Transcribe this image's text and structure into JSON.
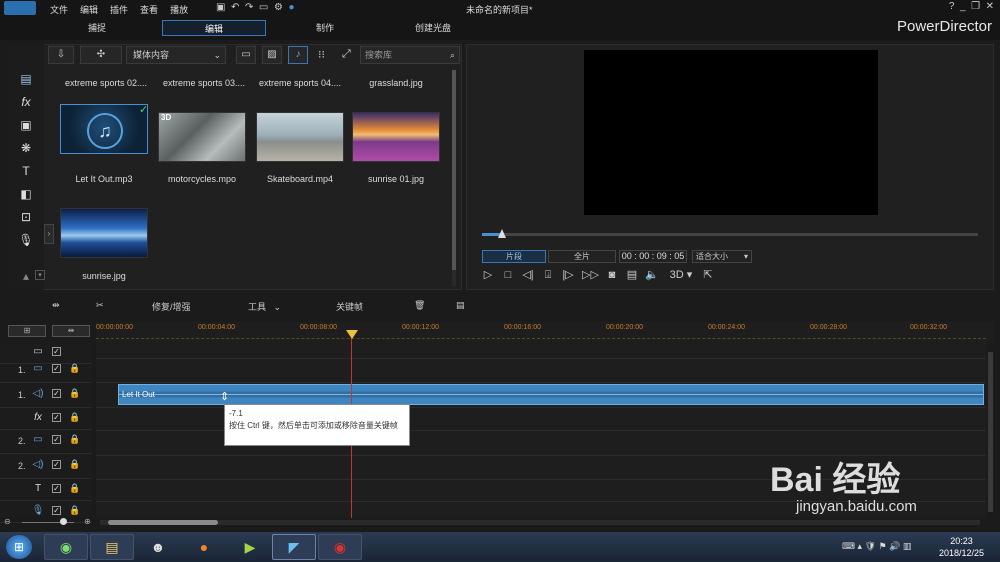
{
  "menu": [
    "文件",
    "编辑",
    "插件",
    "查看",
    "播放"
  ],
  "window_title": "未命名的新项目*",
  "brand": "PowerDirector",
  "mode_tabs": [
    "捕捉",
    "编辑",
    "制作",
    "创建光盘"
  ],
  "library": {
    "dropdown": "媒体内容",
    "search_placeholder": "搜索库",
    "row0": [
      "extreme sports 02....",
      "extreme sports 03....",
      "extreme sports 04....",
      "grassland.jpg"
    ],
    "items": [
      {
        "label": "Let It Out.mp3"
      },
      {
        "label": "motorcycles.mpo",
        "badge": "3D"
      },
      {
        "label": "Skateboard.mp4"
      },
      {
        "label": "sunrise 01.jpg"
      },
      {
        "label": "sunrise.jpg"
      }
    ]
  },
  "preview": {
    "clip_button": "片段",
    "full_button": "全片",
    "timecode": "00 : 00 : 09 : 05",
    "fit": "适合大小",
    "mode3d": "3D"
  },
  "timeline_tools": {
    "fix": "修复/增强",
    "tools": "工具",
    "keyframe": "关键帧"
  },
  "ruler": [
    "00:00:00:00",
    "00:00:04:00",
    "00:00:08:00",
    "00:00:12:00",
    "00:00:16:00",
    "00:00:20:00",
    "00:00:24:00",
    "00:00:28:00",
    "00:00:32:00"
  ],
  "tracks": [
    {
      "num": "",
      "icon": "video-icon"
    },
    {
      "num": "1.",
      "icon": "video-icon"
    },
    {
      "num": "1.",
      "icon": "audio-icon"
    },
    {
      "num": "",
      "icon": "fx-icon"
    },
    {
      "num": "2.",
      "icon": "video-icon"
    },
    {
      "num": "2.",
      "icon": "audio-icon"
    },
    {
      "num": "",
      "icon": "title-icon"
    },
    {
      "num": "",
      "icon": "mic-icon"
    }
  ],
  "clip": {
    "label": "Let It Out"
  },
  "tooltip": {
    "value": "-7.1",
    "text": "按住 Ctrl 键，然后单击可添加或移除音量关键帧"
  },
  "taskbar": {
    "time": "20:23",
    "date": "2018/12/25"
  },
  "watermark": {
    "main": "Bai 经验",
    "url": "jingyan.baidu.com"
  },
  "colors": {
    "accent": "#3f86c1",
    "playhead": "#c0392b",
    "ruler": "#c77e2a"
  }
}
